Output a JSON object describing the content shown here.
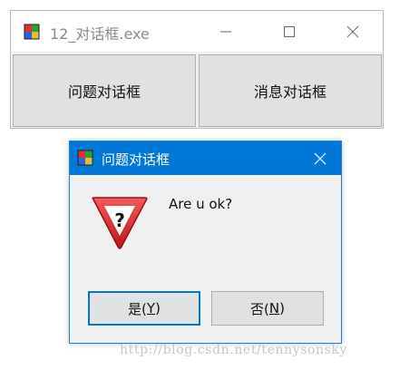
{
  "main_window": {
    "title": "12_对话框.exe",
    "buttons": {
      "question_label": "问题对话框",
      "message_label": "消息对话框"
    }
  },
  "dialog": {
    "title": "问题对话框",
    "message": "Are u ok?",
    "yes_text": "是(",
    "yes_key": "Y",
    "yes_end": ")",
    "no_text": "否(",
    "no_key": "N",
    "no_end": ")"
  },
  "watermark": "http://blog.csdn.net/tennysonsky",
  "colors": {
    "accent": "#0078d7",
    "warning_red": "#d9222a"
  }
}
